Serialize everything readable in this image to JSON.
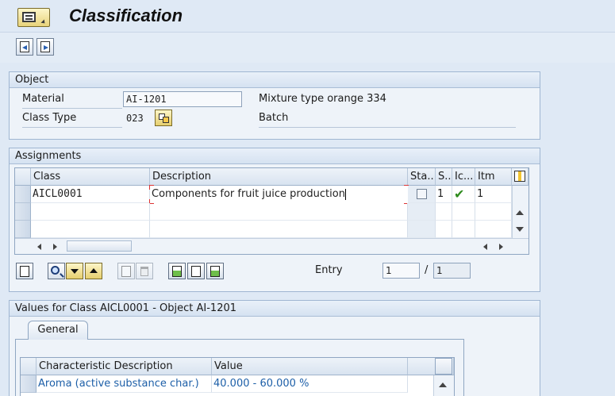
{
  "screen": {
    "title": "Classification"
  },
  "object_section": {
    "title": "Object",
    "material_label": "Material",
    "material_value": "AI-1201",
    "material_desc": "Mixture type orange 334",
    "class_type_label": "Class Type",
    "class_type_value": "023",
    "class_type_desc": "Batch"
  },
  "assignments": {
    "title": "Assignments",
    "columns": [
      "Class",
      "Description",
      "Sta...",
      "S..",
      "Ic...",
      "Itm"
    ],
    "rows": [
      {
        "class": "AICL0001",
        "description": "Components for fruit juice production",
        "status": "1",
        "item": "1"
      }
    ],
    "entry_label": "Entry",
    "entry_value": "1",
    "entry_separator": "/",
    "entry_total": "1"
  },
  "values_section": {
    "title": "Values for Class AICL0001 - Object AI-1201",
    "tabs": [
      {
        "label": "General"
      }
    ],
    "columns": [
      "Characteristic Description",
      "Value"
    ],
    "rows": [
      {
        "description": "Aroma (active substance char.)",
        "value": "40.000 - 60.000 %"
      }
    ]
  },
  "colors": {
    "background": "#dfe9f5",
    "accent_link": "#1d5fa8",
    "check_green": "#2e8b1e"
  },
  "icons": {
    "menu": "menu-icon",
    "prev": "previous-object-icon",
    "next": "next-object-icon",
    "class_type_picker": "possible-entries-icon",
    "check": "green-check-icon"
  }
}
